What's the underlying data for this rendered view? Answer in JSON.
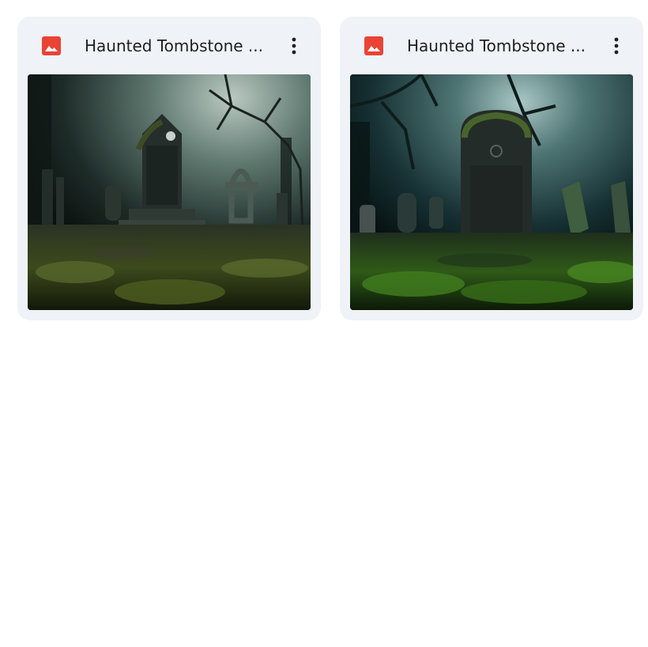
{
  "files": [
    {
      "name": "Haunted Tombstone ...",
      "icon": "image-file-icon",
      "icon_color": "#ea4335",
      "menu_icon": "more-vert-icon"
    },
    {
      "name": "Haunted Tombstone ...",
      "icon": "image-file-icon",
      "icon_color": "#ea4335",
      "menu_icon": "more-vert-icon"
    }
  ],
  "colors": {
    "card_bg": "#eff2f7",
    "title_text": "#1f1f1f",
    "page_bg": "#ffffff"
  }
}
